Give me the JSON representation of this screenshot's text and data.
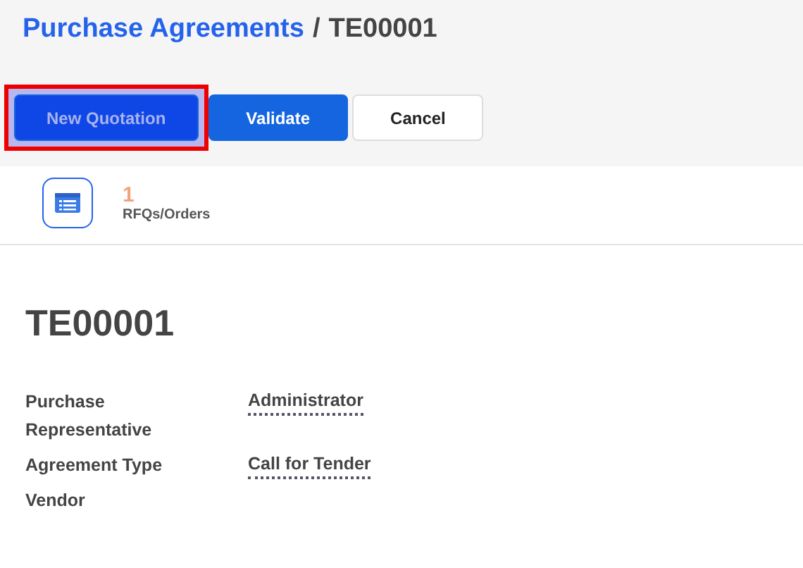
{
  "breadcrumb": {
    "parent": "Purchase Agreements",
    "separator": "/",
    "current": "TE00001"
  },
  "buttons": [
    {
      "label": "New Quotation",
      "kind": "primary",
      "highlighted": true
    },
    {
      "label": "Validate",
      "kind": "primary",
      "highlighted": false
    },
    {
      "label": "Cancel",
      "kind": "secondary",
      "highlighted": false
    }
  ],
  "stat": {
    "count": "1",
    "label": "RFQs/Orders"
  },
  "record": {
    "title": "TE00001"
  },
  "fields": [
    {
      "label": "Purchase Representative",
      "value": "Administrator"
    },
    {
      "label": "Agreement Type",
      "value": "Call for Tender"
    },
    {
      "label": "Vendor"
    }
  ]
}
